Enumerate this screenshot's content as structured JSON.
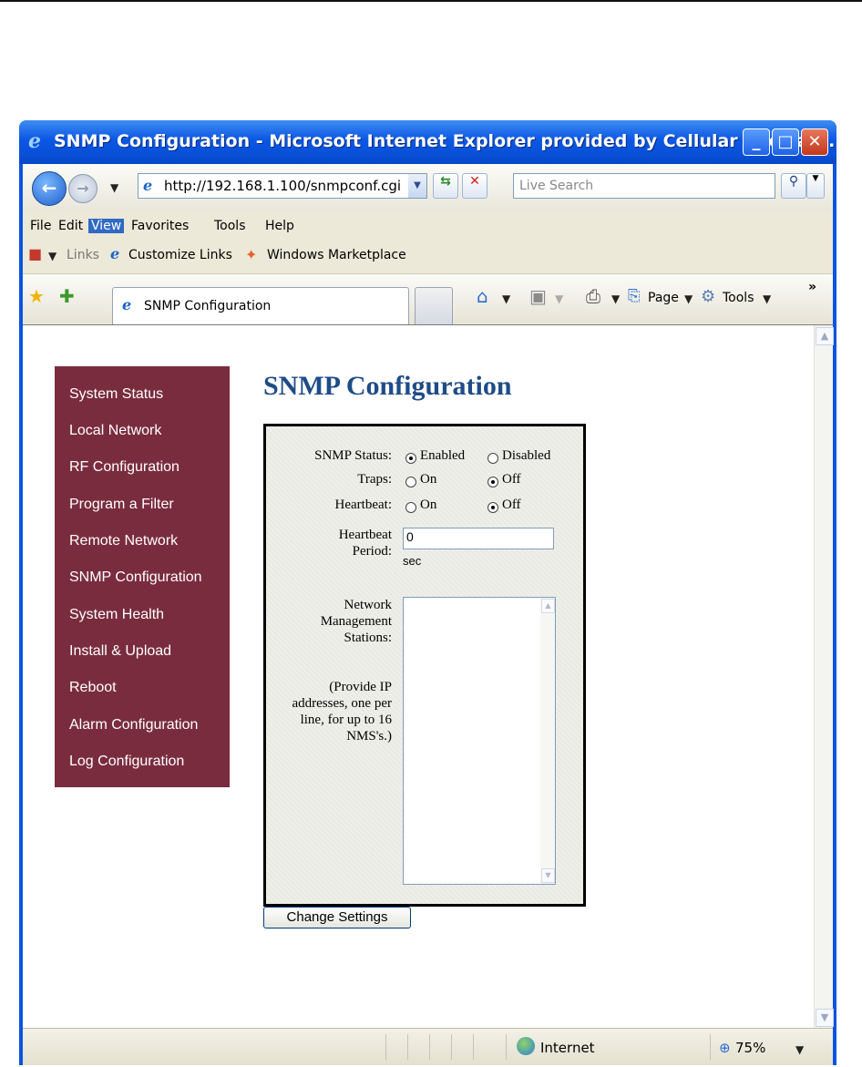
{
  "window": {
    "title": "SNMP Configuration - Microsoft Internet Explorer provided by Cellular Specialti...",
    "minimize": "_",
    "maximize": "□",
    "close": "✕"
  },
  "address": {
    "url": "http://192.168.1.100/snmpconf.cgi",
    "search_placeholder": "Live Search"
  },
  "menu": [
    "File",
    "Edit",
    "View",
    "Favorites",
    "Tools",
    "Help"
  ],
  "links_bar": {
    "label": "Links",
    "items": [
      "Customize Links",
      "Windows Marketplace"
    ]
  },
  "tab": {
    "title": "SNMP Configuration"
  },
  "commands": {
    "page": "Page",
    "tools": "Tools",
    "more": "»"
  },
  "sidebar": {
    "items": [
      "System Status",
      "Local Network",
      "RF Configuration",
      "Program a Filter",
      "Remote Network",
      "SNMP Configuration",
      "System Health",
      "Install & Upload",
      "Reboot",
      "Alarm Configuration",
      "Log Configuration"
    ]
  },
  "page": {
    "title": "SNMP Configuration"
  },
  "form": {
    "snmp_status_label": "SNMP Status:",
    "snmp_enabled": "Enabled",
    "snmp_disabled": "Disabled",
    "traps_label": "Traps:",
    "traps_on": "On",
    "traps_off": "Off",
    "heartbeat_label": "Heartbeat:",
    "heartbeat_on": "On",
    "heartbeat_off": "Off",
    "heartbeat_period_label": "Heartbeat Period:",
    "heartbeat_period_value": "0",
    "heartbeat_period_unit": "sec",
    "nms_label": "Network Management Stations:",
    "nms_help": "(Provide IP addresses, one per line, for up to 16 NMS's.)",
    "nms_value": "",
    "submit": "Change Settings"
  },
  "status": {
    "zone": "Internet",
    "zoom": "75%"
  }
}
